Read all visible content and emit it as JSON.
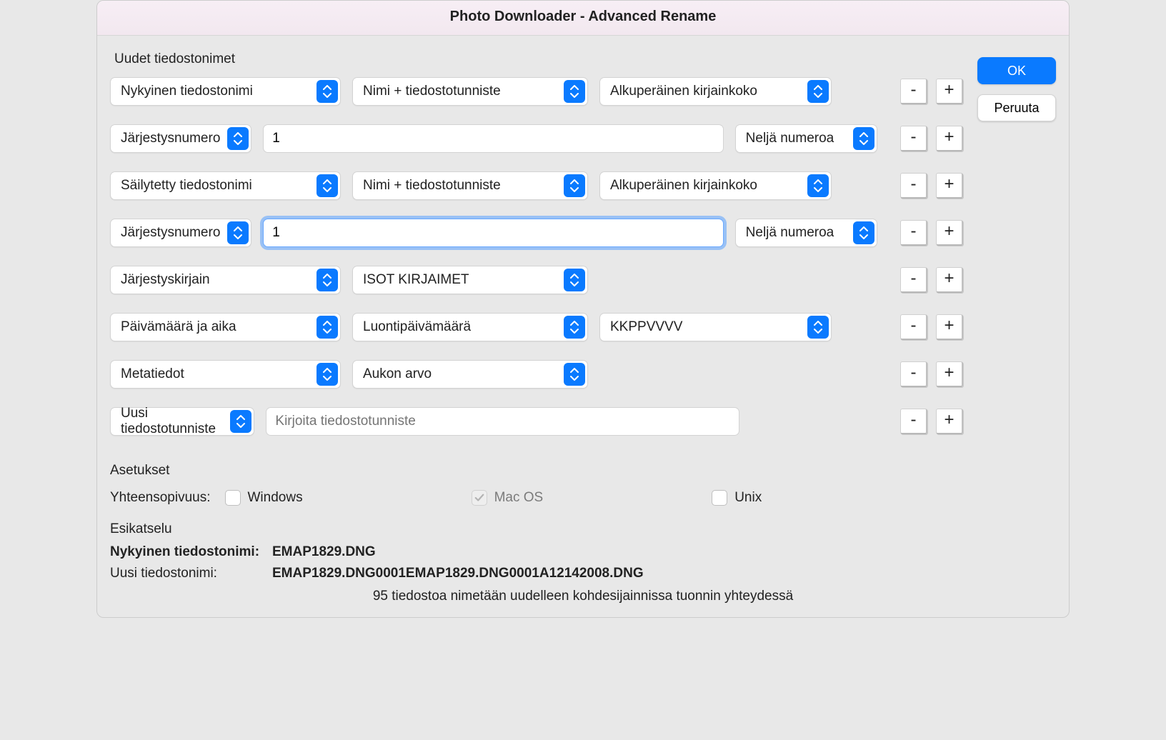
{
  "window": {
    "title": "Photo Downloader - Advanced Rename"
  },
  "buttons": {
    "ok": "OK",
    "cancel": "Peruuta"
  },
  "heading_new_filenames": "Uudet tiedostonimet",
  "rows": [
    {
      "c1": "Nykyinen tiedostonimi",
      "c2_type": "select",
      "c2": "Nimi + tiedostotunniste",
      "c3_type": "select",
      "c3": "Alkuperäinen kirjainkoko"
    },
    {
      "c1": "Järjestysnumero",
      "c2_type": "input",
      "c2": "1",
      "c3_type": "select",
      "c3": "Neljä numeroa"
    },
    {
      "c1": "Säilytetty tiedostonimi",
      "c2_type": "select",
      "c2": "Nimi + tiedostotunniste",
      "c3_type": "select",
      "c3": "Alkuperäinen kirjainkoko"
    },
    {
      "c1": "Järjestysnumero",
      "c2_type": "input",
      "c2": "1",
      "c2_focused": true,
      "c3_type": "select",
      "c3": "Neljä numeroa"
    },
    {
      "c1": "Järjestyskirjain",
      "c2_type": "select",
      "c2": "ISOT KIRJAIMET",
      "c3_type": "none"
    },
    {
      "c1": "Päivämäärä ja aika",
      "c2_type": "select",
      "c2": "Luontipäivämäärä",
      "c3_type": "select",
      "c3": "KKPPVVVV"
    },
    {
      "c1": "Metatiedot",
      "c2_type": "select",
      "c2": "Aukon arvo",
      "c3_type": "none"
    },
    {
      "c1": "Uusi tiedostotunniste",
      "c2_type": "placeholder",
      "c2": "Kirjoita tiedostotunniste",
      "c3_type": "none"
    }
  ],
  "pm": {
    "minus": "-",
    "plus": "+"
  },
  "settings": {
    "heading": "Asetukset",
    "compat_label": "Yhteensopivuus:",
    "windows": {
      "label": "Windows",
      "checked": false,
      "disabled": false
    },
    "macos": {
      "label": "Mac OS",
      "checked": true,
      "disabled": true
    },
    "unix": {
      "label": "Unix",
      "checked": false,
      "disabled": false
    }
  },
  "preview": {
    "heading": "Esikatselu",
    "current_label": "Nykyinen tiedostonimi:",
    "current_value": "EMAP1829.DNG",
    "new_label": "Uusi tiedostonimi:",
    "new_value": "EMAP1829.DNG0001EMAP1829.DNG0001A12142008.DNG",
    "summary": "95 tiedostoa nimetään uudelleen kohdesijainnissa tuonnin yhteydessä"
  }
}
